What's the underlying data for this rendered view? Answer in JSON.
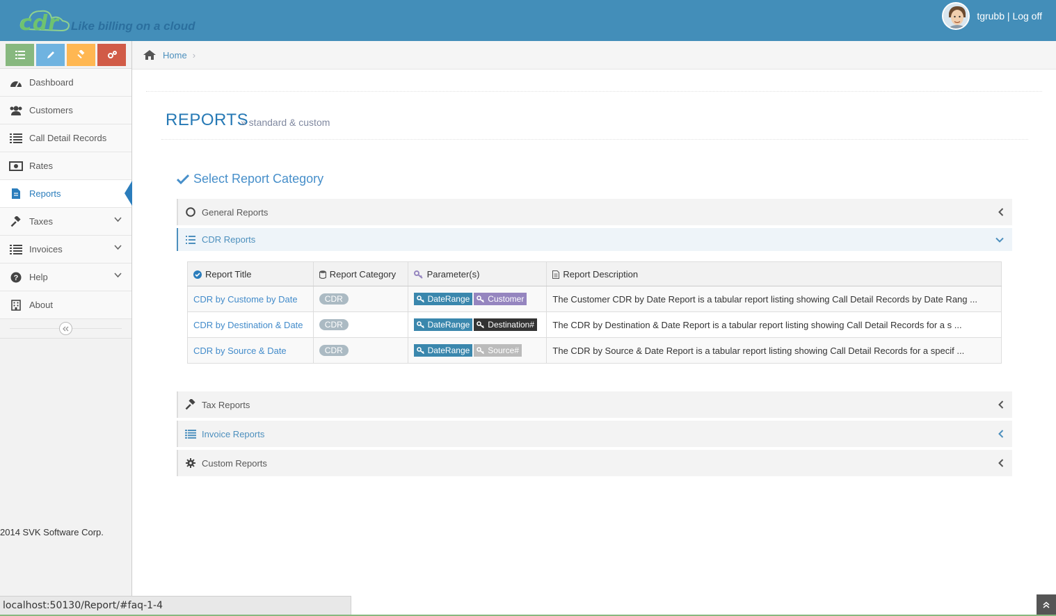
{
  "header": {
    "logo_text": "cdr",
    "tagline": "Like billing on a cloud",
    "username": "tgrubb",
    "separator": " | ",
    "logoff": "Log off"
  },
  "shortcuts": [
    {
      "icon": "list-icon",
      "color": "#87b87f"
    },
    {
      "icon": "pencil-icon",
      "color": "#6fb3e0"
    },
    {
      "icon": "gavel-icon",
      "color": "#ffb752"
    },
    {
      "icon": "cogs-icon",
      "color": "#d15b47"
    }
  ],
  "sidebar": {
    "items": [
      {
        "label": "Dashboard",
        "icon": "dashboard-icon"
      },
      {
        "label": "Customers",
        "icon": "users-icon"
      },
      {
        "label": "Call Detail Records",
        "icon": "list-icon"
      },
      {
        "label": "Rates",
        "icon": "money-icon"
      },
      {
        "label": "Reports",
        "icon": "file-icon",
        "active": true
      },
      {
        "label": "Taxes",
        "icon": "gavel-icon",
        "has_submenu": true
      },
      {
        "label": "Invoices",
        "icon": "list-icon",
        "has_submenu": true
      },
      {
        "label": "Help",
        "icon": "question-icon",
        "has_submenu": true
      },
      {
        "label": "About",
        "icon": "building-icon"
      }
    ],
    "copyright": "2014 SVK Software Corp."
  },
  "breadcrumb": {
    "home": "Home"
  },
  "page": {
    "title": "REPORTS",
    "subtitle": "» standard & custom",
    "section_title": "Select Report Category"
  },
  "categories": [
    {
      "label": "General Reports",
      "icon": "circle-icon",
      "state": "collapsed"
    },
    {
      "label": "CDR Reports",
      "icon": "list-icon",
      "state": "expanded"
    },
    {
      "label": "Tax Reports",
      "icon": "gavel-icon",
      "state": "collapsed"
    },
    {
      "label": "Invoice Reports",
      "icon": "list-icon",
      "state": "collapsed"
    },
    {
      "label": "Custom Reports",
      "icon": "cog-icon",
      "state": "collapsed"
    }
  ],
  "table": {
    "headers": [
      "Report Title",
      "Report Category",
      "Parameter(s)",
      "Report Description"
    ],
    "rows": [
      {
        "title": "CDR by Custome by Date",
        "category": "CDR",
        "params": [
          "DateRange",
          "Customer"
        ],
        "description": "The Customer CDR by Date Report is a tabular report listing showing Call Detail Records by Date Rang ..."
      },
      {
        "title": "CDR by Destination & Date",
        "category": "CDR",
        "params": [
          "DateRange",
          "Destination#"
        ],
        "description": "The CDR by Destination & Date Report is a tabular report listing showing Call Detail Records for a s ..."
      },
      {
        "title": "CDR by Source & Date",
        "category": "CDR",
        "params": [
          "DateRange",
          "Source#"
        ],
        "description": "The CDR by Source & Date Report is a tabular report listing showing Call Detail Records for a specif ..."
      }
    ]
  },
  "colors": {
    "navbar": "#438eb9",
    "accent": "#2b7dbc",
    "link": "#428bca",
    "tag_blue": "#3a87ad",
    "tag_purple": "#9585bf",
    "tag_black": "#333333",
    "tag_gray": "#bbbbbb"
  },
  "statusbar": {
    "url": "localhost:50130/Report/#faq-1-4"
  }
}
